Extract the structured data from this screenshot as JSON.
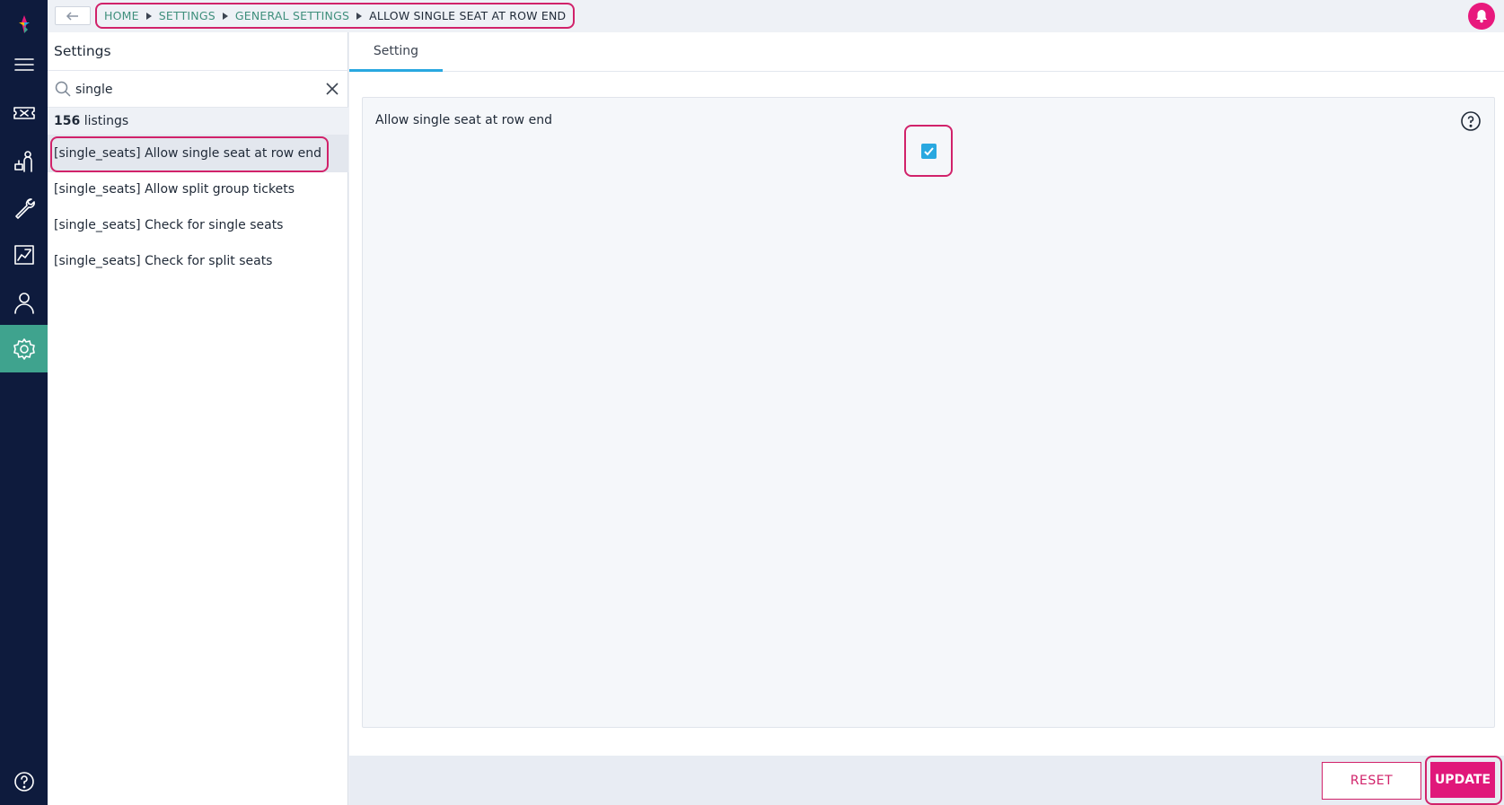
{
  "colors": {
    "rail": "#0e1b3d",
    "rail_active": "#3fa38e",
    "accent_link": "#3f8f7c",
    "tab_underline": "#29a8e0",
    "primary": "#e0187a",
    "annotation": "#d1226a"
  },
  "nav_icons": [
    "logo-icon",
    "menu-icon",
    "ticket-icon",
    "customers-icon",
    "tools-icon",
    "reports-icon",
    "user-icon",
    "settings-icon",
    "help-icon"
  ],
  "breadcrumb": {
    "items": [
      "HOME",
      "SETTINGS",
      "GENERAL SETTINGS"
    ],
    "current": "ALLOW SINGLE SEAT AT ROW END"
  },
  "list": {
    "title": "Settings",
    "search_value": "single",
    "count": "156",
    "count_suffix": "listings",
    "items": [
      "[single_seats] Allow single seat at row end",
      "[single_seats] Allow split group tickets",
      "[single_seats] Check for single seats",
      "[single_seats] Check for split seats"
    ],
    "selected_index": 0
  },
  "main": {
    "tab_label": "Setting",
    "setting_label": "Allow single seat at row end",
    "checkbox_checked": true
  },
  "footer": {
    "reset_label": "RESET",
    "update_label": "UPDATE"
  }
}
